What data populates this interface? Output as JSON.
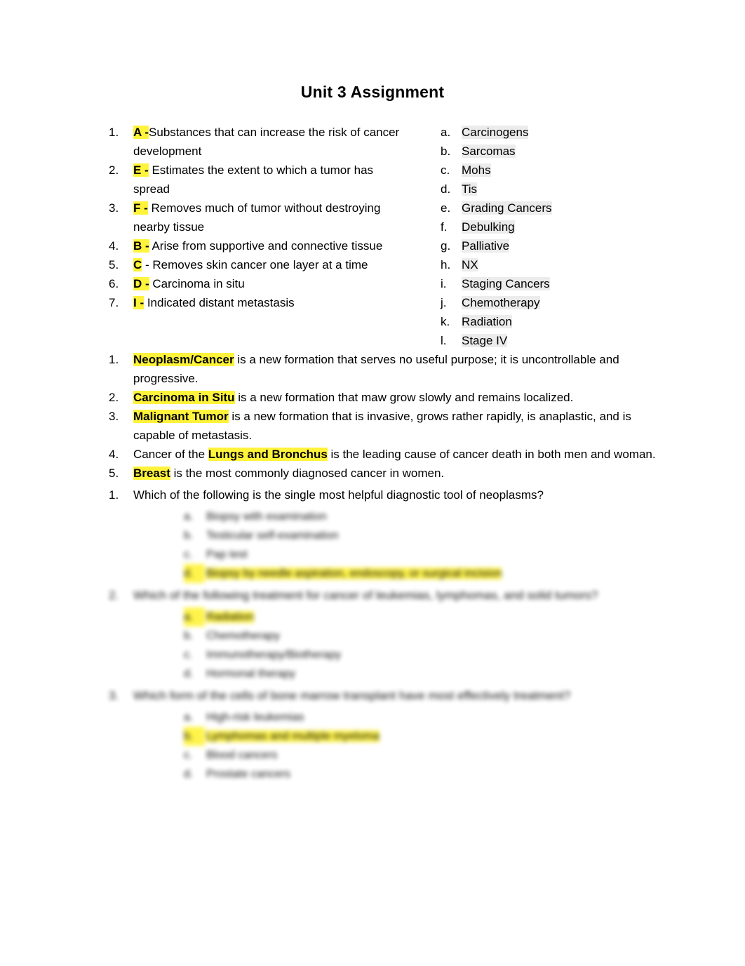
{
  "document": {
    "title": "Unit 3 Assignment"
  },
  "matching": {
    "left": [
      {
        "num": "1.",
        "answer": "A -",
        "text": "Substances that can increase the risk of cancer development"
      },
      {
        "num": "2.",
        "answer": "E -",
        "text": " Estimates the extent to which a tumor has spread"
      },
      {
        "num": "3.",
        "answer": "F -",
        "text": " Removes much of tumor without destroying nearby tissue"
      },
      {
        "num": "4.",
        "answer": "B -",
        "text": " Arise from supportive and connective tissue"
      },
      {
        "num": "5.",
        "answer": "C",
        "text": " - Removes skin cancer one layer at a time"
      },
      {
        "num": "6.",
        "answer": "D -",
        "text": " Carcinoma in situ"
      },
      {
        "num": "7.",
        "answer": "I -",
        "text": " Indicated distant metastasis"
      }
    ],
    "right": [
      {
        "letter": "a.",
        "text": "Carcinogens"
      },
      {
        "letter": "b.",
        "text": "Sarcomas"
      },
      {
        "letter": "c.",
        "text": "Mohs"
      },
      {
        "letter": "d.",
        "text": "Tis"
      },
      {
        "letter": "e.",
        "text": "Grading Cancers"
      },
      {
        "letter": "f.",
        "text": "Debulking"
      },
      {
        "letter": "g.",
        "text": "Palliative"
      },
      {
        "letter": "h.",
        "text": "NX"
      },
      {
        "letter": "i.",
        "text": "Staging Cancers"
      },
      {
        "letter": "j.",
        "text": "Chemotherapy"
      },
      {
        "letter": "k.",
        "text": "Radiation"
      },
      {
        "letter": "l.",
        "text": "Stage IV"
      }
    ]
  },
  "statements": [
    {
      "num": "1.",
      "pre": "",
      "fill": "Neoplasm/Cancer",
      "post": " is a new formation that serves no useful purpose; it is uncontrollable and progressive."
    },
    {
      "num": "2.",
      "pre": "",
      "fill": "Carcinoma in Situ",
      "post": " is a new formation that maw grow slowly and remains localized."
    },
    {
      "num": "3.",
      "pre": "",
      "fill": "Malignant Tumor",
      "post": " is a new formation that is invasive, grows rather rapidly, is anaplastic, and is capable of metastasis."
    },
    {
      "num": "4.",
      "pre": "Cancer of the ",
      "fill": "Lungs and Bronchus",
      "post": " is the leading cause of cancer death in both men and woman."
    },
    {
      "num": "5.",
      "pre": "",
      "fill": "Breast",
      "post": " is the most commonly diagnosed cancer in women."
    }
  ],
  "questions": [
    {
      "num": "1.",
      "text": "Which of the following is the single most helpful diagnostic tool of neoplasms?",
      "blurred": false,
      "choices": [
        {
          "marker": "a.",
          "text": "Biopsy with examination",
          "highlighted": false
        },
        {
          "marker": "b.",
          "text": "Testicular self-examination",
          "highlighted": false
        },
        {
          "marker": "c.",
          "text": "Pap test",
          "highlighted": false
        },
        {
          "marker": "d.",
          "text": "Biopsy by needle aspiration, endoscopy, or surgical incision",
          "highlighted": true
        }
      ]
    },
    {
      "num": "2.",
      "text": "Which of the following treatment for cancer of leukemias, lymphomas, and solid tumors?",
      "blurred": true,
      "choices": [
        {
          "marker": "a.",
          "text": "Radiation",
          "highlighted": true
        },
        {
          "marker": "b.",
          "text": "Chemotherapy",
          "highlighted": false
        },
        {
          "marker": "c.",
          "text": "Immunotherapy/Biotherapy",
          "highlighted": false
        },
        {
          "marker": "d.",
          "text": "Hormonal therapy",
          "highlighted": false
        }
      ]
    },
    {
      "num": "3.",
      "text": "Which form of the cells of bone marrow transplant have most effectively treatment?",
      "blurred": true,
      "choices": [
        {
          "marker": "a.",
          "text": "High-risk leukemias",
          "highlighted": false
        },
        {
          "marker": "b.",
          "text": "Lymphomas and multiple myeloma",
          "highlighted": true
        },
        {
          "marker": "c.",
          "text": "Blood cancers",
          "highlighted": false
        },
        {
          "marker": "d.",
          "text": "Prostate cancers",
          "highlighted": false
        }
      ]
    }
  ]
}
